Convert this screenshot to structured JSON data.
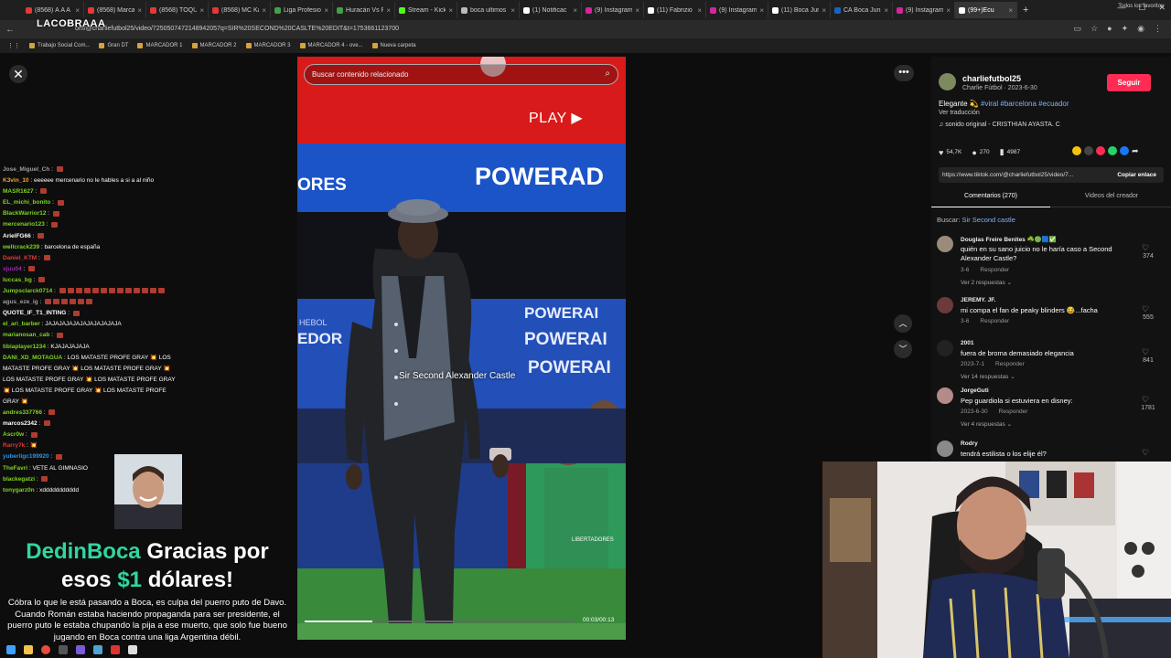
{
  "browser": {
    "tabs": [
      {
        "label": "(8568) À A A",
        "color": "#e53935"
      },
      {
        "label": "(8568) Marca",
        "color": "#e53935"
      },
      {
        "label": "(8568) TOQU",
        "color": "#e53935"
      },
      {
        "label": "(8568) MC Ka",
        "color": "#e53935"
      },
      {
        "label": "Liga Profesio",
        "color": "#43a047"
      },
      {
        "label": "Huracán Vs R",
        "color": "#43a047"
      },
      {
        "label": "Stream - Kick",
        "color": "#53fc18"
      },
      {
        "label": "boca ultimos",
        "color": "#bbbbbb"
      },
      {
        "label": "(1) Notificac",
        "color": "#ffffff"
      },
      {
        "label": "(9) Instagram",
        "color": "#d6249f"
      },
      {
        "label": "(11) Fabrizio",
        "color": "#ffffff"
      },
      {
        "label": "(9) Instagram",
        "color": "#d6249f"
      },
      {
        "label": "(11) Boca Jun",
        "color": "#ffffff"
      },
      {
        "label": "CA Boca Juni",
        "color": "#1565c0"
      },
      {
        "label": "(9) Instagram",
        "color": "#d6249f"
      },
      {
        "label": "(99+)Ecu",
        "color": "#ffffff",
        "active": true
      }
    ],
    "url": "om/@charliefutbol25/video/7250507472148942057q=SIR%20SECOND%20CASLTE%20EDIT&t=1753661123700",
    "bookmarks": [
      "Trabajo Social Com...",
      "Gran DT",
      "MARCADOR 1",
      "MARCADOR 2",
      "MARCADOR 3",
      "MARCADOR 4 - ove...",
      "Nueva carpeta"
    ],
    "bookmarks_right": "Todos los favoritos"
  },
  "overlay_logo": "LACOBRAAA",
  "chat": [
    {
      "user": "Jose_Miguel_Ch",
      "color": "#9e9e9e",
      "text": "",
      "emotes": 1
    },
    {
      "user": "K3vin_10",
      "color": "#f5a623",
      "text": "eeeeee mercenario no le hables a si a al niño",
      "emotes": 0
    },
    {
      "user": "MASR1627",
      "color": "#7ed321",
      "text": "",
      "emotes": 1
    },
    {
      "user": "EL_michi_bonito",
      "color": "#7ed321",
      "text": "",
      "emotes": 1
    },
    {
      "user": "BlackWarrior12",
      "color": "#7ed321",
      "text": "",
      "emotes": 1
    },
    {
      "user": "mercenario123",
      "color": "#7ed321",
      "text": "",
      "emotes": 1
    },
    {
      "user": "ArielFG66",
      "color": "#ffffff",
      "text": "",
      "emotes": 1
    },
    {
      "user": "wellcrack239",
      "color": "#7ed321",
      "text": "barcelona de españa",
      "emotes": 0
    },
    {
      "user": "Daniel_KTM",
      "color": "#e53935",
      "text": "",
      "emotes": 1
    },
    {
      "user": "xjuu04",
      "color": "#9c27b0",
      "text": "",
      "emotes": 1
    },
    {
      "user": "luccas_bg",
      "color": "#7ed321",
      "text": "",
      "emotes": 1
    },
    {
      "user": "Jumpsclarck0714",
      "color": "#7ed321",
      "text": "",
      "emotes": 13
    },
    {
      "user": "agus_eze_ig",
      "color": "#9e9e9e",
      "text": "",
      "emotes": 6
    },
    {
      "user": "QUOTE_IF_T1_INTING",
      "color": "#ffffff",
      "text": "",
      "emotes": 1
    },
    {
      "user": "el_ari_barber",
      "color": "#7ed321",
      "text": "JAJAJAJAJAJAJAJAJAJAJA",
      "emotes": 0
    },
    {
      "user": "marianosan_cab",
      "color": "#7ed321",
      "text": "",
      "emotes": 1
    },
    {
      "user": "tibiaplayer1234",
      "color": "#7ed321",
      "text": "KJAJAJAJAJA",
      "emotes": 0
    },
    {
      "user": "DANI_XD_MOTAGUA",
      "color": "#7ed321",
      "text": "LOS MATASTE PROFE GRAY 💥 LOS MATASTE PROFE GRAY 💥 LOS MATASTE PROFE GRAY 💥 LOS MATASTE PROFE GRAY 💥 LOS MATASTE PROFE GRAY 💥 LOS MATASTE PROFE GRAY 💥 LOS MATASTE PROFE GRAY 💥",
      "emotes": 0,
      "wrap": true
    },
    {
      "user": "andres337766",
      "color": "#7ed321",
      "text": "",
      "emotes": 1
    },
    {
      "user": "marcos2342",
      "color": "#ffffff",
      "text": "",
      "emotes": 1
    },
    {
      "user": "Ascr0w",
      "color": "#7ed321",
      "text": "",
      "emotes": 1
    },
    {
      "user": "Rarry7k",
      "color": "#e53935",
      "text": "💥",
      "emotes": 0
    },
    {
      "user": "yuberligc199920",
      "color": "#2196f3",
      "text": "",
      "emotes": 1
    },
    {
      "user": "TheFavri",
      "color": "#7ed321",
      "text": "VETE AL GIMNASIO",
      "emotes": 0
    },
    {
      "user": "blackegatzi",
      "color": "#7ed321",
      "text": "",
      "emotes": 1
    },
    {
      "user": "tonygarz0n",
      "color": "#7ed321",
      "text": "xddddddddddd",
      "emotes": 0
    }
  ],
  "donation": {
    "name": "DedinBoca",
    "title_middle": "Gracias por esos",
    "amount": "$1",
    "currency_word": "dólares!",
    "message": "Cóbra lo que le está pasando a Boca, es culpa del puerro puto de Davo. Cuando Román estaba haciendo propaganda para ser presidente, el puerro puto le estaba chupando la pija a ese muerto, que solo fue bueno jugando en Boca contra una liga Argentina débil."
  },
  "video": {
    "search_placeholder": "Buscar contenido relacionado",
    "play_label": "PLAY",
    "banner_text": "POWERAD",
    "banner_left": "ORES",
    "board_rows": [
      "POWERAI",
      "POWERAI",
      "POWERAI"
    ],
    "board_left": "EDOR",
    "board_left_small": "HEBOL",
    "bench_logo": "LIBERTADORES",
    "caption": "Sir Second Alexander Castle",
    "time": "00:03/00:13",
    "progress": 0.25
  },
  "panel": {
    "username": "charliefutbol25",
    "subtitle": "Charlie  Fútbol · 2023-6-30",
    "follow_label": "Seguir",
    "description_text": "Elegante",
    "hashtags": "#viral #barcelona #ecuador",
    "translate_label": "Ver traducción",
    "sound": "sonido original - CRISTHIAN AYASTA. C",
    "likes": "54,7K",
    "comments_count": "270",
    "saves": "4987",
    "link": "https://www.tiktok.com/@charliefutbol25/video/7...",
    "copy_label": "Copiar enlace",
    "tab_comments": "Comentarios (270)",
    "tab_creator": "Videos del creador",
    "search_prefix": "Buscar:",
    "search_term": "Sir Second castle",
    "comments": [
      {
        "user": "Douglas Freire Benites ☘️🟢🟦✅",
        "text": "quién en su sano juicio no le haría caso a Second Alexander Castle?",
        "date": "3-6",
        "reply": "Responder",
        "replies": "Ver 2 respuestas",
        "likes": "374",
        "avatar": "#9a8b7a"
      },
      {
        "user": "JEREMY. JF.",
        "text": "mi compa el fan de peaky blinders 😂...facha",
        "date": "3-6",
        "reply": "Responder",
        "replies": "",
        "likes": "555",
        "avatar": "#6b3b3b"
      },
      {
        "user": "2001",
        "text": "fuera de broma demasiado elegancia",
        "date": "2023-7-1",
        "reply": "Responder",
        "replies": "Ver 14 respuestas",
        "likes": "841",
        "avatar": "#222222"
      },
      {
        "user": "JorgeGuti",
        "text": "Pep guardiola si estuviera en disney:",
        "date": "2023-6-30",
        "reply": "Responder",
        "replies": "Ver 4 respuestas",
        "likes": "1781",
        "avatar": "#b48a8a"
      },
      {
        "user": "Rodry",
        "text": "tendrá estilista o los elije él?",
        "date": "",
        "reply": "",
        "replies": "",
        "likes": "",
        "avatar": "#8a8a8a"
      }
    ]
  },
  "colors": {
    "accent_follow": "#fe2c55",
    "donation_green": "#2fd6a0",
    "link_blue": "#7fb2ff"
  }
}
